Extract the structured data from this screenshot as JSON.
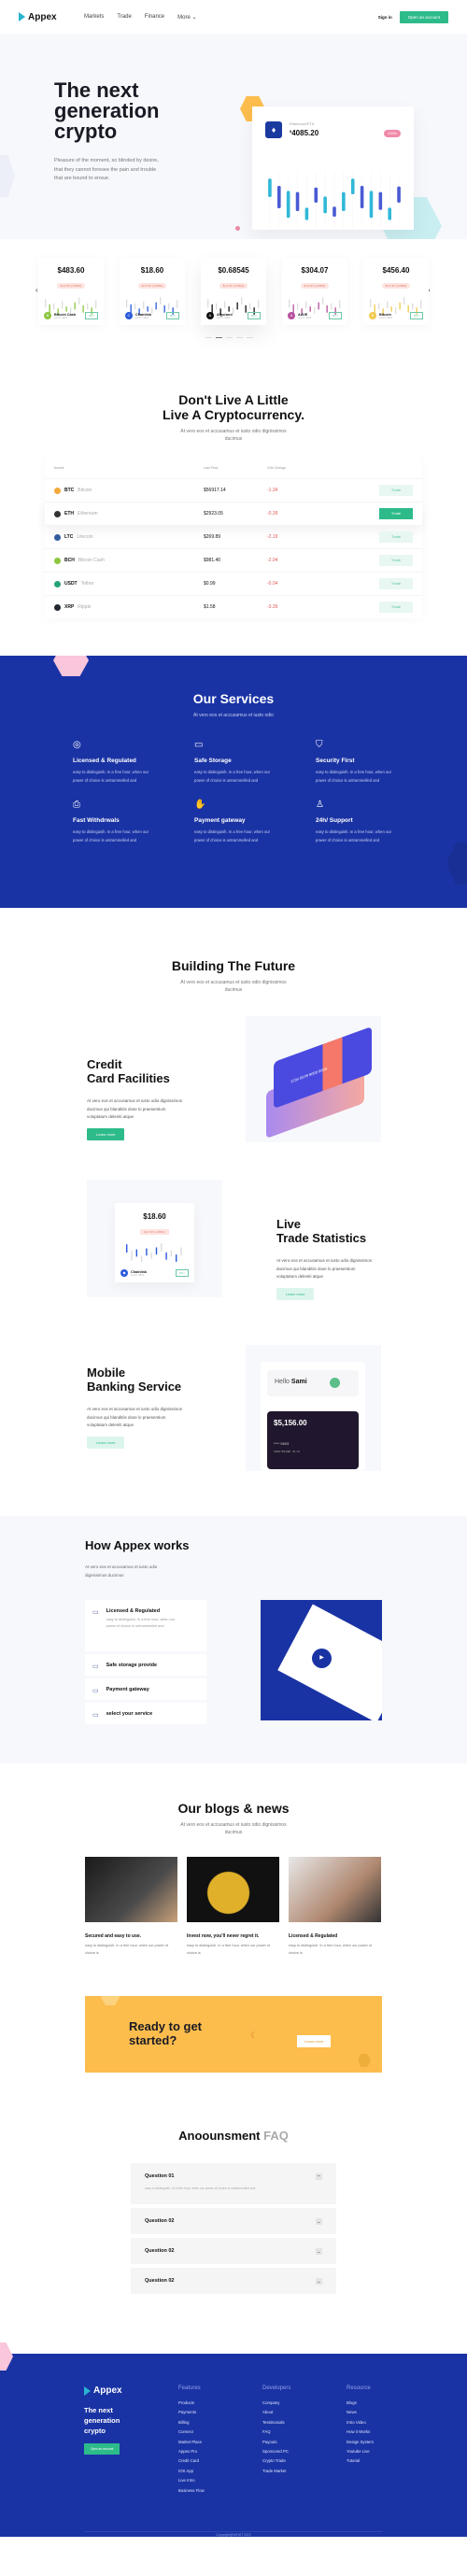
{
  "nav": {
    "brand": "Appex",
    "links": [
      "Markets",
      "Trade",
      "Finance",
      "More"
    ],
    "more_icon": "chevron-down-icon",
    "sign_in": "Sign in",
    "cta": "Open an account"
  },
  "hero": {
    "title": "The next generation crypto",
    "text": "Pleasure of the moment, so blinded by desire, that they cannot foresee the pain and trouble that are bound to ensue.",
    "card": {
      "label": "Ethereum/ETH",
      "currency": "$",
      "price": "4085.20",
      "badge": "4.63%",
      "candles": [
        {
          "lo": 0.55,
          "hi": 0.88,
          "c": "#31b8d8"
        },
        {
          "lo": 0.35,
          "hi": 0.75,
          "c": "#4a5bd4"
        },
        {
          "lo": 0.18,
          "hi": 0.66,
          "c": "#31b8d8"
        },
        {
          "lo": 0.3,
          "hi": 0.64,
          "c": "#4a5bd4"
        },
        {
          "lo": 0.14,
          "hi": 0.36,
          "c": "#31b8d8"
        },
        {
          "lo": 0.45,
          "hi": 0.72,
          "c": "#4a5bd4"
        },
        {
          "lo": 0.26,
          "hi": 0.56,
          "c": "#31b8d8"
        },
        {
          "lo": 0.2,
          "hi": 0.38,
          "c": "#4a5bd4"
        },
        {
          "lo": 0.3,
          "hi": 0.64,
          "c": "#31b8d8"
        },
        {
          "lo": 0.6,
          "hi": 0.88,
          "c": "#31b8d8"
        },
        {
          "lo": 0.35,
          "hi": 0.75,
          "c": "#4a5bd4"
        },
        {
          "lo": 0.18,
          "hi": 0.66,
          "c": "#31b8d8"
        },
        {
          "lo": 0.32,
          "hi": 0.64,
          "c": "#4a5bd4"
        },
        {
          "lo": 0.14,
          "hi": 0.36,
          "c": "#31b8d8"
        },
        {
          "lo": 0.45,
          "hi": 0.74,
          "c": "#4a5bd4"
        }
      ]
    }
  },
  "coins": [
    {
      "price": "$483.60",
      "badge": "$-17.97 (-3.65%)",
      "name": "Bitcoin Cash",
      "date": "Jul 27, 2021",
      "color": "#8cc63f",
      "buy": "BUY"
    },
    {
      "price": "$18.60",
      "badge": "$-17.97 (-3.65%)",
      "name": "Chainlink",
      "date": "Jul 27, 2021",
      "color": "#2a5ada",
      "buy": "BUY"
    },
    {
      "price": "$0.68545",
      "badge": "$-17.97 (-3.65%)",
      "name": "Algorand",
      "date": "Jul 27, 2021",
      "color": "#111111",
      "buy": "BUY"
    },
    {
      "price": "$304.07",
      "badge": "$-17.97 (-3.65%)",
      "name": "AAVE",
      "date": "Jul 27, 2021",
      "color": "#b6509e",
      "buy": "BUY"
    },
    {
      "price": "$456.40",
      "badge": "$-17.97 (-3.65%)",
      "name": "Bitcoin",
      "date": "Jul 27, 2021",
      "color": "#f2c94c",
      "buy": "BUY"
    }
  ],
  "market": {
    "title1": "Don't Live A Little",
    "title2": "Live A Cryptocurrency.",
    "subtitle": "At vero eos et accusamus et iusto odio dignissimos ducimus",
    "headers": [
      "Assets",
      "Last Price",
      "24th Change",
      ""
    ],
    "rows": [
      {
        "sym": "BTC",
        "name": "Bitcoin",
        "price": "$56917.14",
        "change": "-1.34",
        "color": "#f2a93b",
        "trade": "Trade"
      },
      {
        "sym": "ETH",
        "name": "Ethereum",
        "price": "$2923.05",
        "change": "-0.39",
        "color": "#333333",
        "trade": "Trade"
      },
      {
        "sym": "LTC",
        "name": "Litecoin",
        "price": "$269.89",
        "change": "-2.19",
        "color": "#345d9d",
        "trade": "Trade"
      },
      {
        "sym": "BCH",
        "name": "Bitcoin Cash",
        "price": "$981.40",
        "change": "-2.04",
        "color": "#8cc63f",
        "trade": "Trade"
      },
      {
        "sym": "USDT",
        "name": "Tether",
        "price": "$0.99",
        "change": "-0.04",
        "color": "#26a17b",
        "trade": "Trade"
      },
      {
        "sym": "XRP",
        "name": "Ripple",
        "price": "$1.58",
        "change": "-3.39",
        "color": "#23292f",
        "trade": "Trade"
      }
    ]
  },
  "services": {
    "title": "Our Services",
    "subtitle": "At vero eos et accusamus et iusto odio",
    "items": [
      {
        "icon": "license-icon",
        "glyph": "◎",
        "title": "Licensed & Regulated",
        "text": "easy to distinguish. In a free hour, when our power of choice is untrammelled and"
      },
      {
        "icon": "storage-icon",
        "glyph": "▭",
        "title": "Safe Storage",
        "text": "easy to distinguish. In a free hour, when our power of choice is untrammelled and"
      },
      {
        "icon": "shield-icon",
        "glyph": "⛉",
        "title": "Security First",
        "text": "easy to distinguish. In a free hour, when our power of choice is untrammelled and"
      },
      {
        "icon": "withdraw-icon",
        "glyph": "⎙",
        "title": "Fast Withdrwals",
        "text": "easy to distinguish. In a free hour, when our power of choice is untrammelled and"
      },
      {
        "icon": "payment-icon",
        "glyph": "✋",
        "title": "Payment gateway",
        "text": "easy to distinguish. In a free hour, when our power of choice is untrammelled and"
      },
      {
        "icon": "support-icon",
        "glyph": "♙",
        "title": "24h/ Support",
        "text": "easy to distinguish. In a free hour, when our power of choice is untrammelled and"
      }
    ]
  },
  "future": {
    "title": "Building The Future",
    "subtitle": "At vero eos et accusamus et iusto odio dignissimos ducimus",
    "features": [
      {
        "title1": "Credit",
        "title2": "Card Facilities",
        "text": "At vero eos et accusamus et iusto odio dignissimos ducimus qui blanditiis dose lo praesentium voluptatum deleniti atque",
        "button": "Learn more"
      },
      {
        "title1": "Live",
        "title2": "Trade Statistics",
        "text": "At vero eos et accusamus et iusto odio dignissimos ducimus qui blanditiis dose lo praesentium voluptatum deleniti atque",
        "button": "Learn more"
      },
      {
        "title1": "Mobile",
        "title2": "Banking Service",
        "text": "At vero eos et accusamus et iusto odio dignissimos ducimus qui blanditiis dose lo praesentium voluptatum deleniti atque",
        "button": "Learn more"
      }
    ],
    "card_numbers": "1234 5678 9000 0000",
    "stat_card": {
      "price": "$18.60",
      "badge": "$-17.97 (-3.65%)",
      "name": "Chainlink",
      "date": "Jul 27, 2021",
      "buy": "BUY"
    },
    "bank": {
      "hello": "Hello",
      "user": "Sami",
      "balance": "$5,156.00",
      "card": "**** 5693",
      "holder": "CARD HOLDER",
      "exp": "09 / 24"
    }
  },
  "how": {
    "title": "How Appex works",
    "subtitle": "At vero eos et accusamus et iusto odio dignissimos ducimus",
    "items": [
      {
        "title": "Licensed & Regulated",
        "text": "easy to distinguish. In a free hour, when our power of choice is untrammelled and"
      },
      {
        "title": "Safe storage provide"
      },
      {
        "title": "Payment gateway"
      },
      {
        "title": "select your service"
      }
    ]
  },
  "blogs": {
    "title": "Our blogs & news",
    "subtitle": "At vero eos et accusamus et iusto odio dignissimos ducimus",
    "posts": [
      {
        "title": "Secured and easy to use.",
        "text": "easy to distinguish. In a free hour, when our power of choice is"
      },
      {
        "title": "Invest now, you'll never regret it.",
        "text": "easy to distinguish. In a free hour, when our power of choice is"
      },
      {
        "title": "Licensed & Regulated",
        "text": "easy to distinguish. In a free hour, when our power of choice is"
      }
    ]
  },
  "cta": {
    "title": "Ready to get started?",
    "button": "Learn more"
  },
  "faq": {
    "title": "Anoounsment",
    "title_light": "FAQ",
    "items": [
      {
        "q": "Question 01",
        "a": "easy to distinguish. In a free hour, when our power of choice is untrammelled and",
        "open": true
      },
      {
        "q": "Question 02",
        "open": false
      },
      {
        "q": "Question 02",
        "open": false
      },
      {
        "q": "Question 02",
        "open": false
      }
    ]
  },
  "footer": {
    "brand": "Appex",
    "tagline": "The next generation crypto",
    "button": "Open an account",
    "columns": [
      {
        "heading": "Features",
        "links": [
          "Products",
          "Payments",
          "Billing",
          "Connect",
          "Market Place",
          "Appex Pro",
          "Credit Card",
          "IOS App",
          "Live Intro",
          "Business Flow"
        ]
      },
      {
        "heading": "Developers",
        "links": [
          "Company",
          "About",
          "Testimonials",
          "FAQ",
          "Payouts",
          "Sponcored PC",
          "Crypto Trade",
          "Trade Market"
        ]
      },
      {
        "heading": "Resource",
        "links": [
          "Blogs",
          "News",
          "Intro Video",
          "How it Works",
          "Design System",
          "Youtube Live",
          "Tutorial"
        ]
      }
    ],
    "copyright": "Copyright@UIHUT 2021"
  }
}
